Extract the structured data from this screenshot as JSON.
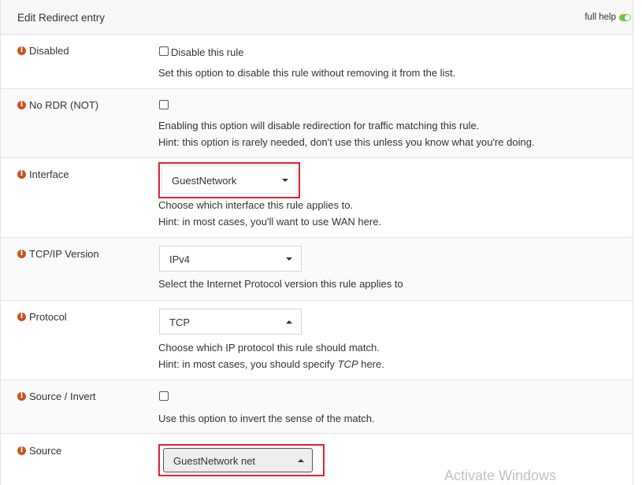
{
  "header": {
    "title": "Edit Redirect entry",
    "full_help_label": "full help"
  },
  "rows": {
    "disabled": {
      "label": "Disabled",
      "checkbox_label": "Disable this rule",
      "help": "Set this option to disable this rule without removing it from the list."
    },
    "no_rdr": {
      "label": "No RDR (NOT)",
      "help1": "Enabling this option will disable redirection for traffic matching this rule.",
      "help2": "Hint: this option is rarely needed, don't use this unless you know what you're doing."
    },
    "interface": {
      "label": "Interface",
      "value": "GuestNetwork",
      "help1": "Choose which interface this rule applies to.",
      "help2": "Hint: in most cases, you'll want to use WAN here."
    },
    "ipversion": {
      "label": "TCP/IP Version",
      "value": "IPv4",
      "help": "Select the Internet Protocol version this rule applies to"
    },
    "protocol": {
      "label": "Protocol",
      "value": "TCP",
      "help1": "Choose which IP protocol this rule should match.",
      "help2_pre": "Hint: in most cases, you should specify ",
      "help2_em": "TCP",
      "help2_post": " here."
    },
    "source_invert": {
      "label": "Source / Invert",
      "help": "Use this option to invert the sense of the match."
    },
    "source": {
      "label": "Source",
      "value": "GuestNetwork net"
    }
  },
  "watermark": "Activate Windows",
  "colors": {
    "info_icon": "#c8541a",
    "highlight": "#e0232b",
    "toggle": "#6ec73c"
  }
}
